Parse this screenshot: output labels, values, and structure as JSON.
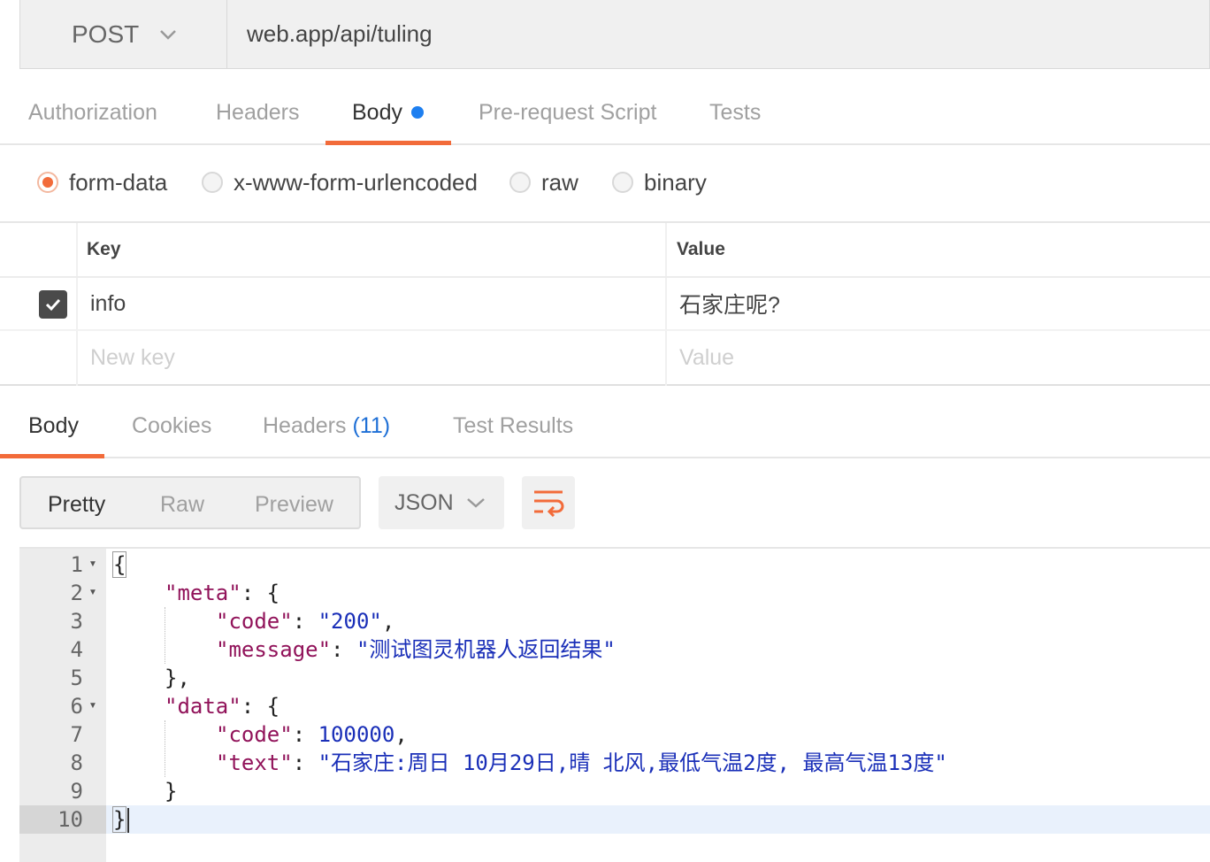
{
  "request": {
    "method": "POST",
    "url": "web.app/api/tuling"
  },
  "request_tabs": [
    {
      "label": "Authorization",
      "active": false
    },
    {
      "label": "Headers",
      "active": false
    },
    {
      "label": "Body",
      "active": true,
      "indicator_color": "#1e7ff0"
    },
    {
      "label": "Pre-request Script",
      "active": false
    },
    {
      "label": "Tests",
      "active": false
    }
  ],
  "body_types": [
    {
      "label": "form-data",
      "selected": true
    },
    {
      "label": "x-www-form-urlencoded",
      "selected": false
    },
    {
      "label": "raw",
      "selected": false
    },
    {
      "label": "binary",
      "selected": false
    }
  ],
  "params_table": {
    "headers": {
      "key": "Key",
      "value": "Value"
    },
    "rows": [
      {
        "enabled": true,
        "key": "info",
        "value": "石家庄呢?"
      }
    ],
    "new_row": {
      "key_placeholder": "New key",
      "value_placeholder": "Value"
    }
  },
  "response_tabs": [
    {
      "label": "Body",
      "active": true
    },
    {
      "label": "Cookies",
      "active": false
    },
    {
      "label": "Headers",
      "count": "(11)",
      "active": false
    },
    {
      "label": "Test Results",
      "active": false
    }
  ],
  "view_modes": [
    {
      "label": "Pretty",
      "active": true
    },
    {
      "label": "Raw",
      "active": false
    },
    {
      "label": "Preview",
      "active": false
    }
  ],
  "format_select": {
    "value": "JSON"
  },
  "wrap_button": {
    "icon": "wrap-lines-icon"
  },
  "editor": {
    "line_numbers": [
      "1",
      "2",
      "3",
      "4",
      "5",
      "6",
      "7",
      "8",
      "9",
      "10"
    ],
    "lines": {
      "l1": "{",
      "l2_key": "\"meta\"",
      "l2_rest": ": {",
      "l3_key": "\"code\"",
      "l3_colon": ": ",
      "l3_val": "\"200\"",
      "l3_end": ",",
      "l4_key": "\"message\"",
      "l4_colon": ": ",
      "l4_val": "\"测试图灵机器人返回结果\"",
      "l5": "},",
      "l6_key": "\"data\"",
      "l6_rest": ": {",
      "l7_key": "\"code\"",
      "l7_colon": ": ",
      "l7_val": "100000",
      "l7_end": ",",
      "l8_key": "\"text\"",
      "l8_colon": ": ",
      "l8_val": "\"石家庄:周日 10月29日,晴 北风,最低气温2度, 最高气温13度\"",
      "l9": "}",
      "l10": "}"
    },
    "active_line": "10"
  },
  "colors": {
    "accent": "#f26b3a",
    "json_key": "#91135a",
    "json_string": "#1a2fb8",
    "badge_count": "#1e6fd6"
  }
}
